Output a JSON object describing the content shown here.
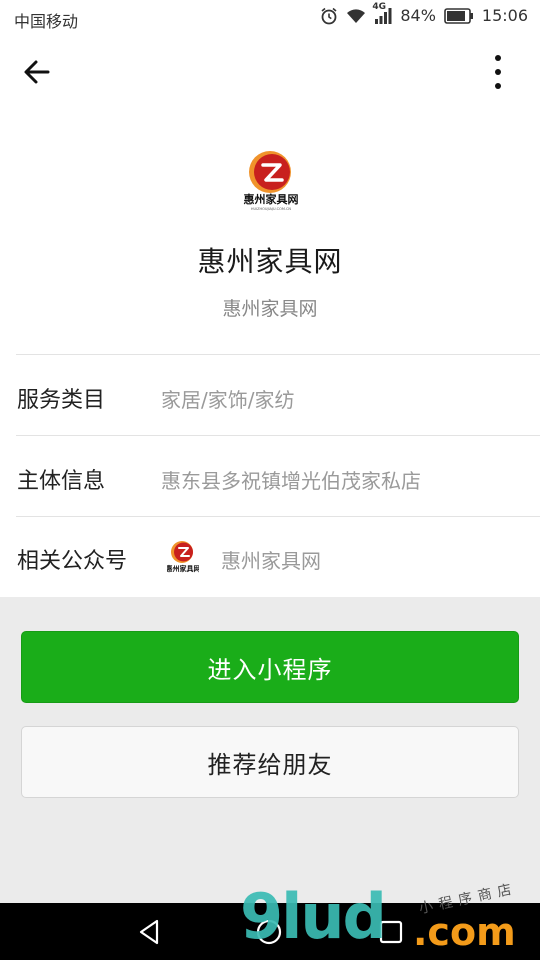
{
  "status_bar": {
    "carrier": "中国移动",
    "network": "4G",
    "battery": "84%",
    "time": "15:06"
  },
  "nav": {
    "back_icon": "arrow-left-icon",
    "more_icon": "more-vertical-icon"
  },
  "profile": {
    "logo_text": "惠州家具网",
    "logo_subtext": "HUIZHOUJIAJU.COM.CN",
    "name": "惠州家具网",
    "subtitle": "惠州家具网"
  },
  "info": {
    "service_category": {
      "label": "服务类目",
      "value": "家居/家饰/家纺"
    },
    "entity_info": {
      "label": "主体信息",
      "value": "惠东县多祝镇增光伯茂家私店"
    },
    "related_account": {
      "label": "相关公众号",
      "value": "惠州家具网"
    }
  },
  "actions": {
    "enter_label": "进入小程序",
    "share_label": "推荐给朋友"
  },
  "watermark": {
    "main": "9lud",
    "com": ".com",
    "small": "小程序商店"
  },
  "colors": {
    "primary_green": "#1aad19",
    "logo_red": "#c8201e",
    "logo_orange": "#f0932b"
  }
}
